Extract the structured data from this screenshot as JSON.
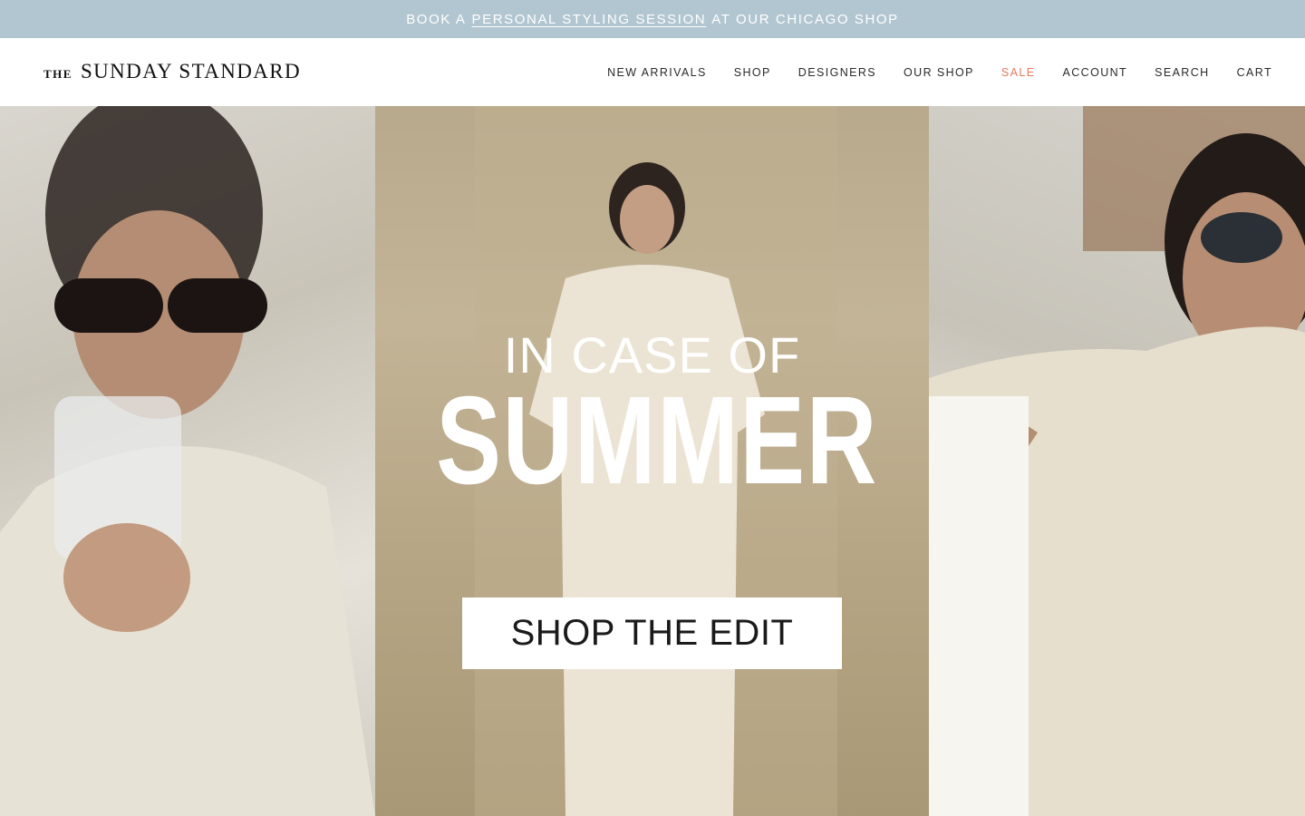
{
  "announcement": {
    "prefix": "BOOK A",
    "link": "PERSONAL STYLING SESSION",
    "suffix": "AT OUR CHICAGO SHOP"
  },
  "header": {
    "logo_small": "THE",
    "logo_main": "SUNDAY STANDARD",
    "nav": [
      {
        "label": "NEW ARRIVALS"
      },
      {
        "label": "SHOP"
      },
      {
        "label": "DESIGNERS"
      },
      {
        "label": "OUR SHOP"
      },
      {
        "label": "SALE",
        "color": "#e67a5f"
      },
      {
        "label": "ACCOUNT"
      },
      {
        "label": "SEARCH"
      },
      {
        "label": "CART"
      }
    ]
  },
  "hero": {
    "eyebrow": "IN CASE OF",
    "title": "SUMMER",
    "cta": "SHOP THE EDIT"
  },
  "colors": {
    "announcement_bg": "#b2c6d1",
    "sale": "#e67a5f",
    "text": "#1a1a1a"
  }
}
